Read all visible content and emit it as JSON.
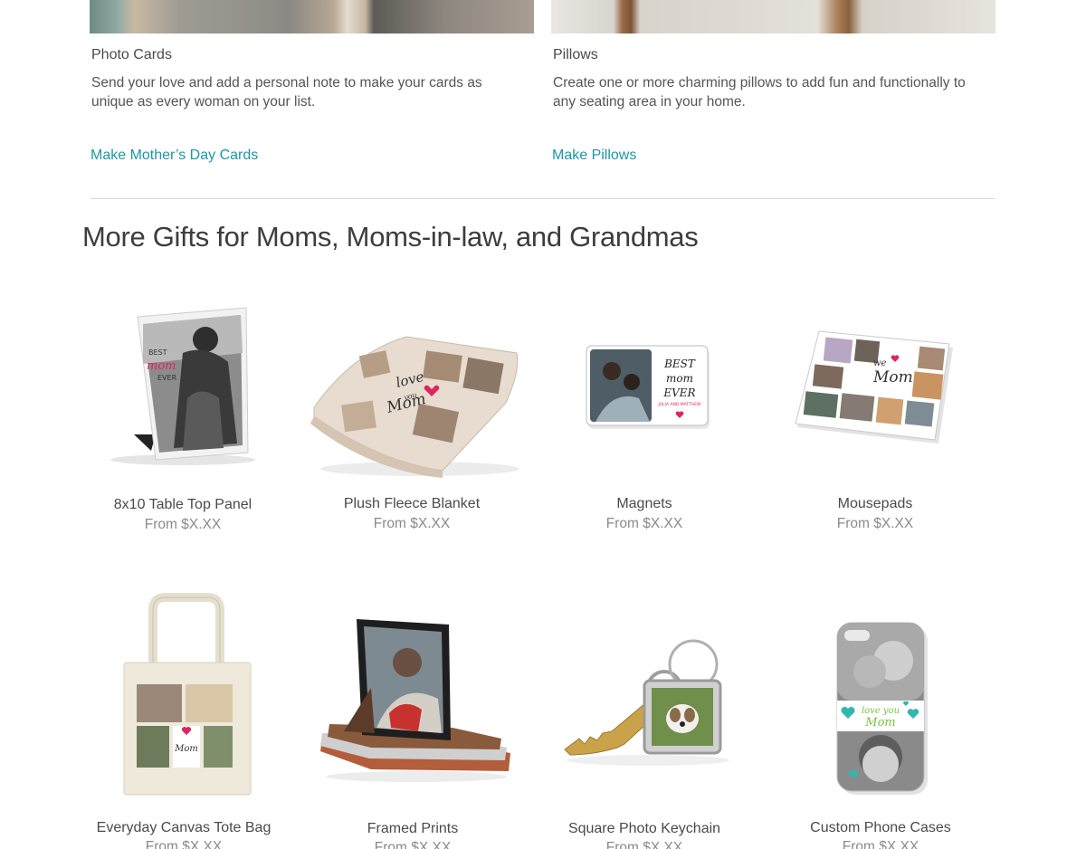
{
  "features": [
    {
      "title": "Photo Cards",
      "description": "Send your love and add a personal note to make your cards as unique as every woman on your list.",
      "link": "Make Mother’s Day Cards"
    },
    {
      "title": "Pillows",
      "description": "Create one or more charming pillows to add fun and functionally to any seating area in your home.",
      "link": "Make Pillows"
    }
  ],
  "section_title": "More Gifts for Moms, Moms-in-law, and Grandmas",
  "products": [
    {
      "name": "8x10 Table Top Panel",
      "price": "From $X.XX",
      "art": {
        "best": "BEST",
        "mom": "mom",
        "ever": "EVER"
      }
    },
    {
      "name": "Plush Fleece Blanket",
      "price": "From $X.XX",
      "art": {
        "love": "love",
        "you": "you",
        "mom": "Mom"
      }
    },
    {
      "name": "Magnets",
      "price": "From $X.XX",
      "art": {
        "best": "BEST",
        "mom": "mom",
        "ever": "EVER",
        "names": "JULIA AND MATTHEW"
      }
    },
    {
      "name": "Mousepads",
      "price": "From $X.XX",
      "art": {
        "we": "we",
        "mom": "Mom"
      }
    },
    {
      "name": "Everyday Canvas Tote Bag",
      "price": "From $X.XX",
      "art": {
        "mom": "Mom"
      }
    },
    {
      "name": "Framed Prints",
      "price": "From $X.XX"
    },
    {
      "name": "Square Photo Keychain",
      "price": "From $X.XX"
    },
    {
      "name": "Custom Phone Cases",
      "price": "From $X.XX",
      "art": {
        "love_you": "love you",
        "mom": "Mom"
      }
    }
  ],
  "colors": {
    "link": "#1a98a8",
    "accent_pink": "#e0245e",
    "accent_teal": "#2fb7b0",
    "accent_green": "#7cc142"
  }
}
